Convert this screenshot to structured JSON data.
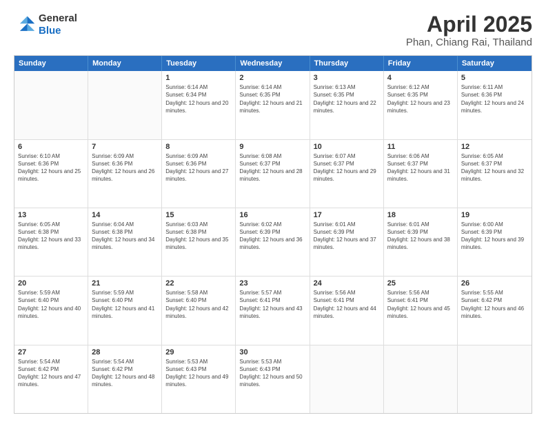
{
  "header": {
    "logo": {
      "line1": "General",
      "line2": "Blue"
    },
    "title": "April 2025",
    "subtitle": "Phan, Chiang Rai, Thailand"
  },
  "weekdays": [
    "Sunday",
    "Monday",
    "Tuesday",
    "Wednesday",
    "Thursday",
    "Friday",
    "Saturday"
  ],
  "weeks": [
    [
      {
        "day": "",
        "empty": true
      },
      {
        "day": "",
        "empty": true
      },
      {
        "day": "1",
        "sunrise": "6:14 AM",
        "sunset": "6:34 PM",
        "daylight": "12 hours and 20 minutes."
      },
      {
        "day": "2",
        "sunrise": "6:14 AM",
        "sunset": "6:35 PM",
        "daylight": "12 hours and 21 minutes."
      },
      {
        "day": "3",
        "sunrise": "6:13 AM",
        "sunset": "6:35 PM",
        "daylight": "12 hours and 22 minutes."
      },
      {
        "day": "4",
        "sunrise": "6:12 AM",
        "sunset": "6:35 PM",
        "daylight": "12 hours and 23 minutes."
      },
      {
        "day": "5",
        "sunrise": "6:11 AM",
        "sunset": "6:36 PM",
        "daylight": "12 hours and 24 minutes."
      }
    ],
    [
      {
        "day": "6",
        "sunrise": "6:10 AM",
        "sunset": "6:36 PM",
        "daylight": "12 hours and 25 minutes."
      },
      {
        "day": "7",
        "sunrise": "6:09 AM",
        "sunset": "6:36 PM",
        "daylight": "12 hours and 26 minutes."
      },
      {
        "day": "8",
        "sunrise": "6:09 AM",
        "sunset": "6:36 PM",
        "daylight": "12 hours and 27 minutes."
      },
      {
        "day": "9",
        "sunrise": "6:08 AM",
        "sunset": "6:37 PM",
        "daylight": "12 hours and 28 minutes."
      },
      {
        "day": "10",
        "sunrise": "6:07 AM",
        "sunset": "6:37 PM",
        "daylight": "12 hours and 29 minutes."
      },
      {
        "day": "11",
        "sunrise": "6:06 AM",
        "sunset": "6:37 PM",
        "daylight": "12 hours and 31 minutes."
      },
      {
        "day": "12",
        "sunrise": "6:05 AM",
        "sunset": "6:37 PM",
        "daylight": "12 hours and 32 minutes."
      }
    ],
    [
      {
        "day": "13",
        "sunrise": "6:05 AM",
        "sunset": "6:38 PM",
        "daylight": "12 hours and 33 minutes."
      },
      {
        "day": "14",
        "sunrise": "6:04 AM",
        "sunset": "6:38 PM",
        "daylight": "12 hours and 34 minutes."
      },
      {
        "day": "15",
        "sunrise": "6:03 AM",
        "sunset": "6:38 PM",
        "daylight": "12 hours and 35 minutes."
      },
      {
        "day": "16",
        "sunrise": "6:02 AM",
        "sunset": "6:39 PM",
        "daylight": "12 hours and 36 minutes."
      },
      {
        "day": "17",
        "sunrise": "6:01 AM",
        "sunset": "6:39 PM",
        "daylight": "12 hours and 37 minutes."
      },
      {
        "day": "18",
        "sunrise": "6:01 AM",
        "sunset": "6:39 PM",
        "daylight": "12 hours and 38 minutes."
      },
      {
        "day": "19",
        "sunrise": "6:00 AM",
        "sunset": "6:39 PM",
        "daylight": "12 hours and 39 minutes."
      }
    ],
    [
      {
        "day": "20",
        "sunrise": "5:59 AM",
        "sunset": "6:40 PM",
        "daylight": "12 hours and 40 minutes."
      },
      {
        "day": "21",
        "sunrise": "5:59 AM",
        "sunset": "6:40 PM",
        "daylight": "12 hours and 41 minutes."
      },
      {
        "day": "22",
        "sunrise": "5:58 AM",
        "sunset": "6:40 PM",
        "daylight": "12 hours and 42 minutes."
      },
      {
        "day": "23",
        "sunrise": "5:57 AM",
        "sunset": "6:41 PM",
        "daylight": "12 hours and 43 minutes."
      },
      {
        "day": "24",
        "sunrise": "5:56 AM",
        "sunset": "6:41 PM",
        "daylight": "12 hours and 44 minutes."
      },
      {
        "day": "25",
        "sunrise": "5:56 AM",
        "sunset": "6:41 PM",
        "daylight": "12 hours and 45 minutes."
      },
      {
        "day": "26",
        "sunrise": "5:55 AM",
        "sunset": "6:42 PM",
        "daylight": "12 hours and 46 minutes."
      }
    ],
    [
      {
        "day": "27",
        "sunrise": "5:54 AM",
        "sunset": "6:42 PM",
        "daylight": "12 hours and 47 minutes."
      },
      {
        "day": "28",
        "sunrise": "5:54 AM",
        "sunset": "6:42 PM",
        "daylight": "12 hours and 48 minutes."
      },
      {
        "day": "29",
        "sunrise": "5:53 AM",
        "sunset": "6:43 PM",
        "daylight": "12 hours and 49 minutes."
      },
      {
        "day": "30",
        "sunrise": "5:53 AM",
        "sunset": "6:43 PM",
        "daylight": "12 hours and 50 minutes."
      },
      {
        "day": "",
        "empty": true
      },
      {
        "day": "",
        "empty": true
      },
      {
        "day": "",
        "empty": true
      }
    ]
  ]
}
